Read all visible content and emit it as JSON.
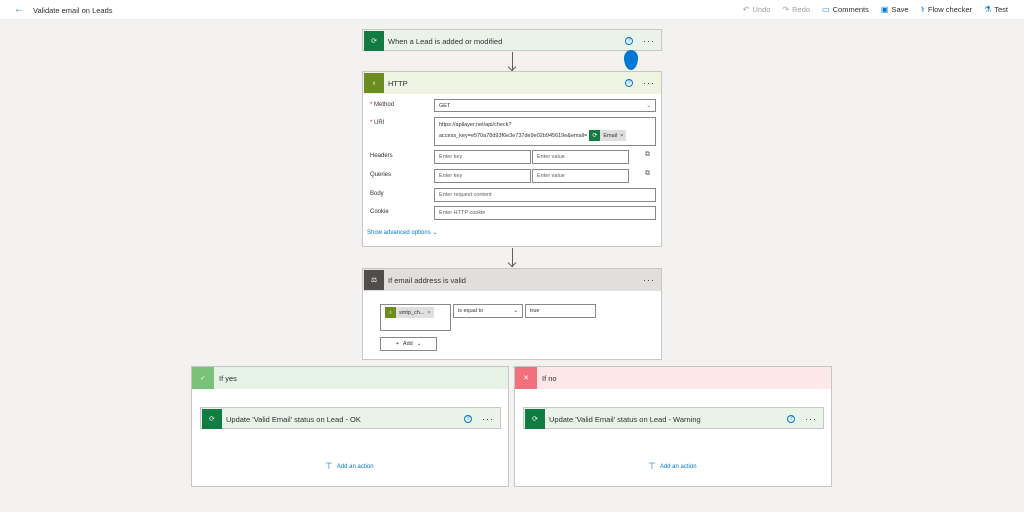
{
  "topbar": {
    "title": "Validate email on Leads",
    "undo": "Undo",
    "redo": "Redo",
    "comments": "Comments",
    "save": "Save",
    "flow_checker": "Flow checker",
    "test": "Test"
  },
  "trigger": {
    "title": "When a Lead is added or modified"
  },
  "http": {
    "title": "HTTP",
    "method_label": "Method",
    "method_value": "GET",
    "uri_label": "URI",
    "uri_line1": "https://apilayer.net/api/check?",
    "uri_line2": "access_key=e570a78d93f6e3e737de9e02b945619e&email=",
    "uri_tag": "Email",
    "headers_label": "Headers",
    "queries_label": "Queries",
    "body_label": "Body",
    "cookie_label": "Cookie",
    "key_placeholder": "Enter key",
    "value_placeholder": "Enter value",
    "body_placeholder": "Enter request content",
    "cookie_placeholder": "Enter HTTP cookie",
    "advanced": "Show advanced options"
  },
  "condition": {
    "title": "If email address is valid",
    "token": "smtp_ch...",
    "operator": "is equal to",
    "value": "true",
    "add": "Add"
  },
  "yes": {
    "label": "If yes",
    "action": "Update 'Valid Email' status on Lead - OK",
    "add_action": "Add an action"
  },
  "no": {
    "label": "If no",
    "action": "Update 'Valid Email' status on Lead - Warning",
    "add_action": "Add an action"
  },
  "colors": {
    "accent": "#0078d4",
    "dataverse": "#107c41",
    "http": "#6a8c21",
    "yes_header": "#e6f2e6",
    "no_header": "#fde7e9"
  },
  "icons": [
    "back-arrow-icon",
    "undo-icon",
    "redo-icon",
    "comment-icon",
    "save-icon",
    "flow-checker-icon",
    "test-icon",
    "dataverse-icon",
    "globe-icon",
    "condition-icon",
    "help-icon",
    "more-icon",
    "check-icon",
    "x-icon",
    "add-action-icon"
  ]
}
